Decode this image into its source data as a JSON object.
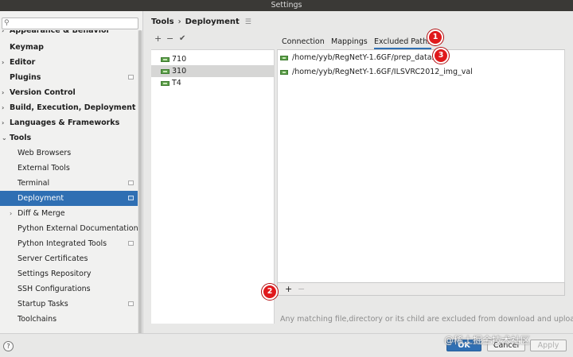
{
  "window": {
    "title": "Settings"
  },
  "search": {
    "placeholder": "",
    "icon": "search-icon"
  },
  "sidebar": {
    "items": [
      {
        "label": "Appearance & Behavior",
        "bold": true,
        "arrow": "›"
      },
      {
        "label": "Keymap",
        "bold": true
      },
      {
        "label": "Editor",
        "bold": true,
        "arrow": "›"
      },
      {
        "label": "Plugins",
        "bold": true
      },
      {
        "label": "Version Control",
        "bold": true,
        "arrow": "›"
      },
      {
        "label": "Build, Execution, Deployment",
        "bold": true,
        "arrow": "›"
      },
      {
        "label": "Languages & Frameworks",
        "bold": true,
        "arrow": "›"
      },
      {
        "label": "Tools",
        "bold": true,
        "arrow": "⌄"
      },
      {
        "label": "Web Browsers"
      },
      {
        "label": "External Tools"
      },
      {
        "label": "Terminal"
      },
      {
        "label": "Deployment",
        "selected": true
      },
      {
        "label": "Diff & Merge",
        "arrow": "›"
      },
      {
        "label": "Python External Documentation"
      },
      {
        "label": "Python Integrated Tools"
      },
      {
        "label": "Server Certificates"
      },
      {
        "label": "Settings Repository"
      },
      {
        "label": "SSH Configurations"
      },
      {
        "label": "Startup Tasks"
      },
      {
        "label": "Toolchains"
      }
    ]
  },
  "breadcrumb": {
    "parent": "Tools",
    "separator": "›",
    "current": "Deployment"
  },
  "server_toolbar": {
    "add": "+",
    "remove": "−",
    "check": "✔"
  },
  "servers": [
    {
      "name": "710"
    },
    {
      "name": "310",
      "selected": true
    },
    {
      "name": "T4"
    }
  ],
  "tabs": [
    {
      "label": "Connection"
    },
    {
      "label": "Mappings"
    },
    {
      "label": "Excluded Paths",
      "active": true
    }
  ],
  "excluded_paths": [
    "/home/yyb/RegNetY-1.6GF/prep_dataset",
    "/home/yyb/RegNetY-1.6GF/ILSVRC2012_img_val"
  ],
  "path_toolbar": {
    "add": "+",
    "remove": "−"
  },
  "hint": "Any matching file,directory or its child are excluded from download and upload",
  "buttons": {
    "help": "?",
    "ok": "OK",
    "cancel": "Cancel",
    "apply": "Apply"
  },
  "watermark": "@稀土掘金技术社区",
  "markers": [
    "1",
    "2",
    "3"
  ],
  "colors": {
    "accent": "#2f6fb3",
    "marker": "#e0191c",
    "server_icon": "#5c9f4a"
  }
}
